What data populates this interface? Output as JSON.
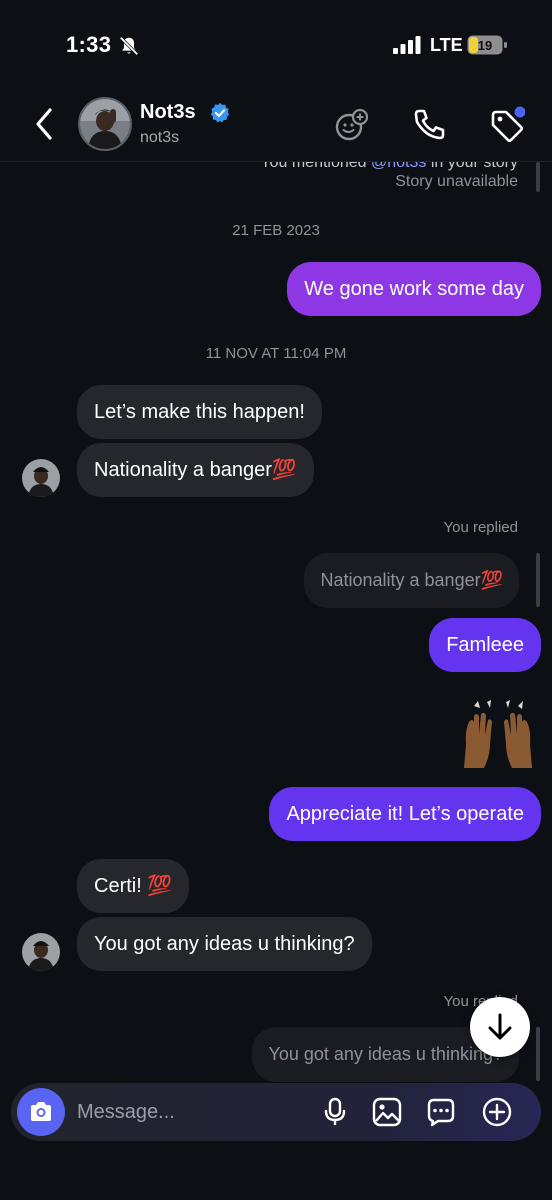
{
  "status_bar": {
    "time": "1:33",
    "network": "LTE",
    "battery": "19"
  },
  "header": {
    "name": "Not3s",
    "username": "not3s"
  },
  "story": {
    "prefix": "You mentioned ",
    "mention": "@not3s",
    "suffix": " in your story",
    "status": "Story unavailable"
  },
  "messages": {
    "date1": "21 FEB 2023",
    "m1": "We gone work some day",
    "date2": "11 NOV AT 11:04 PM",
    "m2": "Let’s make this happen!",
    "m3": "Nationality a banger💯",
    "reply_label1": "You replied",
    "reply_quote1": "Nationality a banger💯",
    "m4": "Famleee",
    "m5": "Appreciate it! Let’s operate",
    "m6": "Certi! 💯",
    "m7": "You got any ideas u thinking?",
    "reply_label2": "You replied",
    "reply_quote2": "You got any ideas u thinking?"
  },
  "composer": {
    "placeholder": "Message..."
  },
  "icons": {
    "back": "chevron-left-icon",
    "verified": "verified-badge-icon",
    "effects": "effects-icon",
    "call": "phone-icon",
    "tag": "tag-icon",
    "camera": "camera-icon",
    "mic": "microphone-icon",
    "gallery": "gallery-icon",
    "sticker": "sticker-icon",
    "plus": "plus-icon",
    "scroll": "arrow-down-icon"
  },
  "colors": {
    "sent_purple": "#8d37e5",
    "sent_blue": "#6534ef",
    "received": "#25272d",
    "camera": "#5a64f2",
    "verified": "#3797f0"
  }
}
